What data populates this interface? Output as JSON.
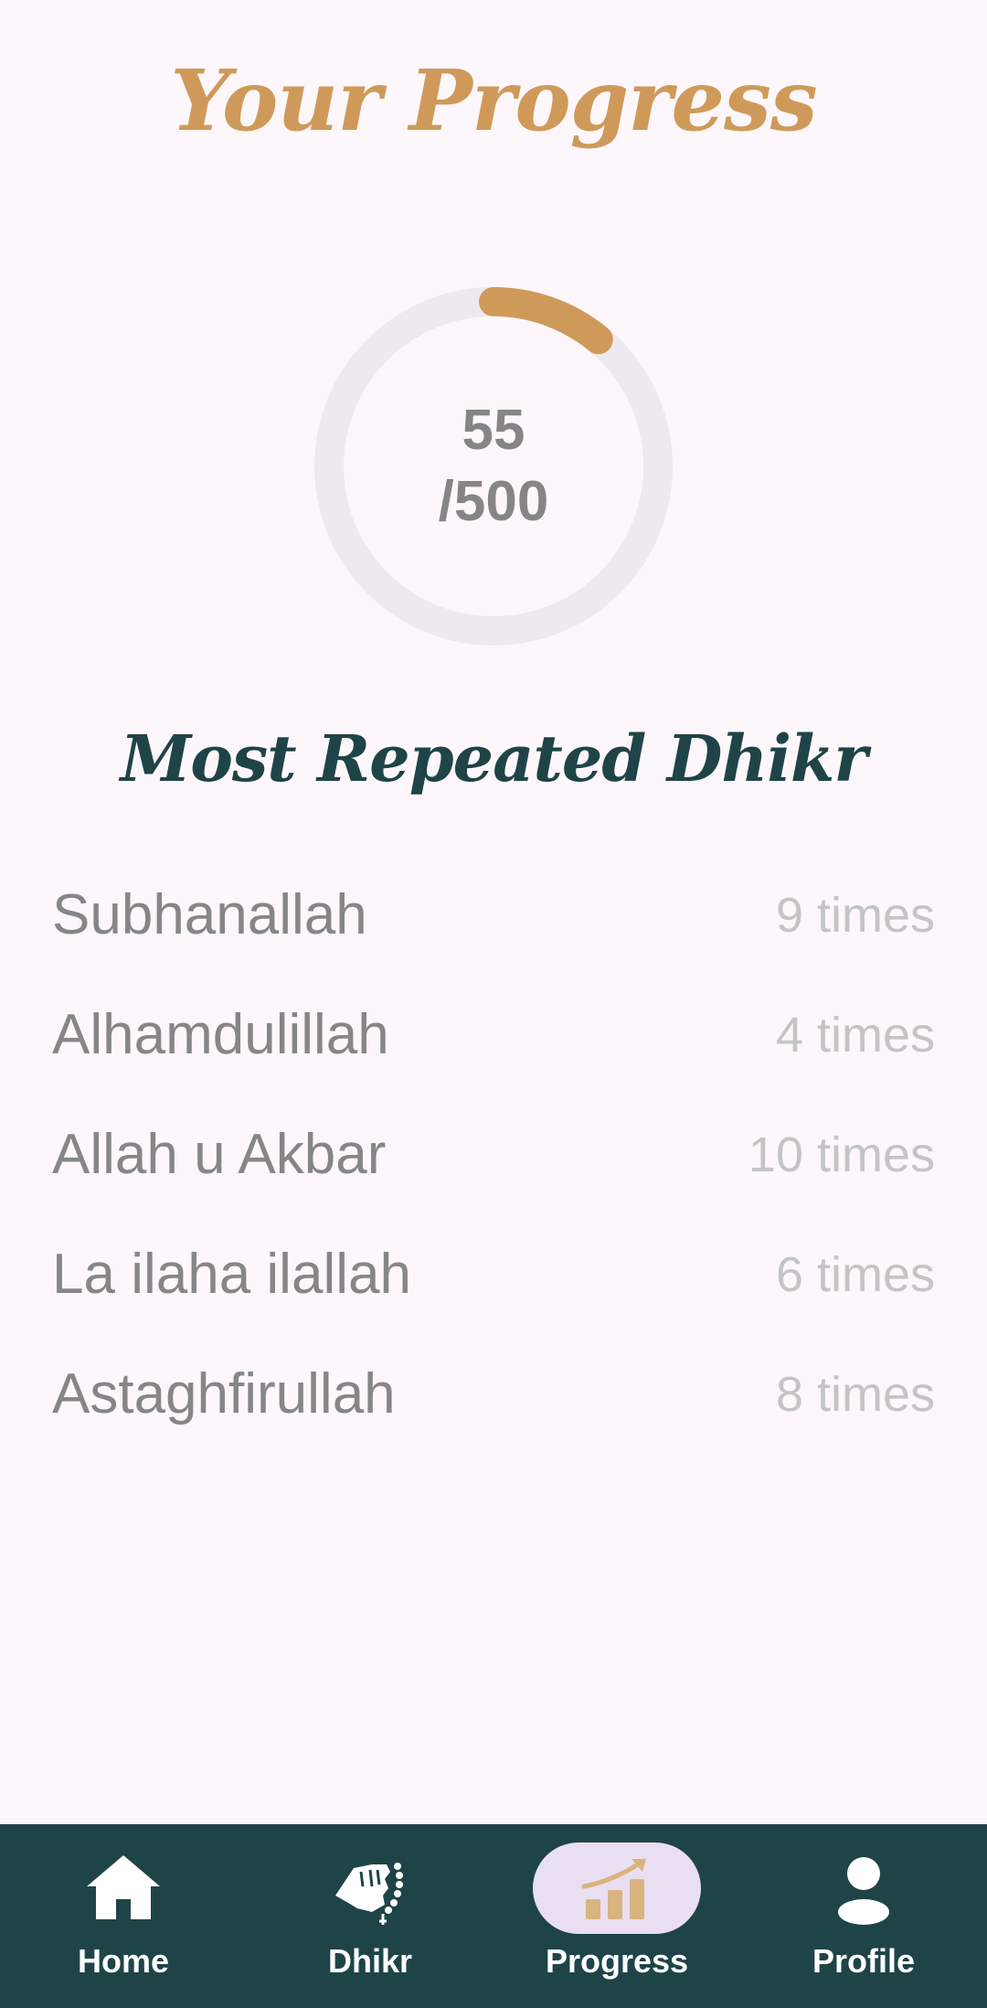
{
  "header": {
    "title": "Your Progress"
  },
  "progress": {
    "current": "55",
    "total": "/500",
    "fraction": 0.11,
    "track_color": "#EEE9EE",
    "fill_color": "#CF9A59"
  },
  "section": {
    "title": "Most Repeated Dhikr"
  },
  "dhikr_list": [
    {
      "name": "Subhanallah",
      "count": "9 times"
    },
    {
      "name": "Alhamdulillah",
      "count": "4 times"
    },
    {
      "name": "Allah u Akbar",
      "count": "10 times"
    },
    {
      "name": "La ilaha ilallah",
      "count": "6 times"
    },
    {
      "name": "Astaghfirullah",
      "count": "8 times"
    }
  ],
  "nav": {
    "items": [
      {
        "label": "Home",
        "icon": "home-icon",
        "active": false
      },
      {
        "label": "Dhikr",
        "icon": "prayer-hand-icon",
        "active": false
      },
      {
        "label": "Progress",
        "icon": "chart-icon",
        "active": true
      },
      {
        "label": "Profile",
        "icon": "person-icon",
        "active": false
      }
    ],
    "background": "#1F4447",
    "active_pill_color": "#EADFF2"
  },
  "colors": {
    "background": "#FDF7FC",
    "accent": "#CF9A59",
    "dark_teal": "#1F4447",
    "name_text": "#868686",
    "count_text": "#C4C4C4"
  }
}
